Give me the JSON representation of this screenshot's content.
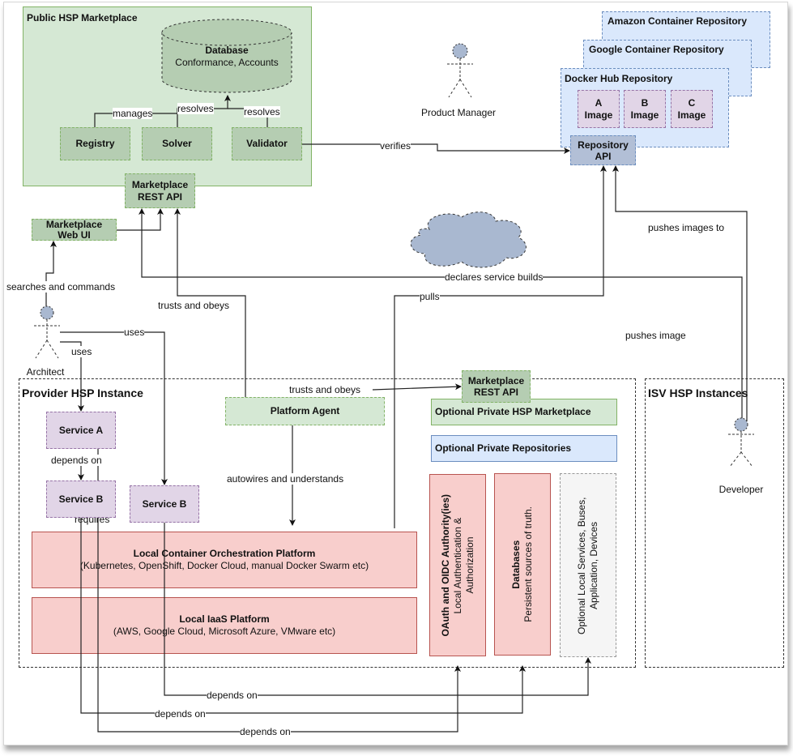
{
  "public_marketplace": {
    "title": "Public HSP Marketplace",
    "database": {
      "title": "Database",
      "subtitle": "Conformance, Accounts"
    },
    "registry": "Registry",
    "solver": "Solver",
    "validator": "Validator",
    "rest_api": "Marketplace\nREST API",
    "web_ui": "Marketplace\nWeb UI"
  },
  "repositories": {
    "amazon": "Amazon Container Repository",
    "google": "Google Container Repository",
    "dockerhub": "Docker Hub Repository",
    "images": [
      {
        "letter": "A",
        "label": "Image"
      },
      {
        "letter": "B",
        "label": "Image"
      },
      {
        "letter": "C",
        "label": "Image"
      }
    ],
    "api": "Repository\nAPI"
  },
  "actors": {
    "product_manager": "Product Manager",
    "architect": "Architect",
    "developer": "Developer"
  },
  "provider": {
    "title": "Provider HSP Instance",
    "service_a": "Service A",
    "service_b1": "Service B",
    "service_b2": "Service B",
    "platform_agent": "Platform Agent",
    "marketplace_rest_api": "Marketplace\nREST API",
    "private_marketplace": "Optional Private HSP Marketplace",
    "private_repositories": "Optional Private Repositories",
    "orchestration": {
      "title": "Local Container Orchestration Platform",
      "subtitle": "(Kubernetes, OpenShift, Docker Cloud, manual Docker Swarm etc)"
    },
    "iaas": {
      "title": "Local IaaS Platform",
      "subtitle": "(AWS, Google Cloud, Microsoft Azure, VMware etc)"
    },
    "oauth": {
      "title": "OAuth and OIDC Authority(ies)",
      "subtitle": "Local Authentication & Authorization"
    },
    "databases": {
      "title": "Databases",
      "subtitle": "Persistent sources of truth."
    },
    "optional_local": "Optional Local Services, Buses, Application, Devices"
  },
  "isv": {
    "title": "ISV HSP Instances"
  },
  "edges": {
    "manages": "manages",
    "resolves_solver": "resolves",
    "resolves_validator": "resolves",
    "verifies": "verifies",
    "searches": "searches and commands",
    "trusts_obeys_1": "trusts and obeys",
    "trusts_obeys_2": "trusts and obeys",
    "uses_1": "uses",
    "uses_2": "uses",
    "declares": "declares service builds",
    "pulls": "pulls",
    "pushes_images_to": "pushes images to",
    "pushes_image": "pushes image",
    "depends_on_ab": "depends on",
    "requires": "requires",
    "autowires": "autowires and understands",
    "depends_on_1": "depends on",
    "depends_on_2": "depends on",
    "depends_on_3": "depends on"
  }
}
